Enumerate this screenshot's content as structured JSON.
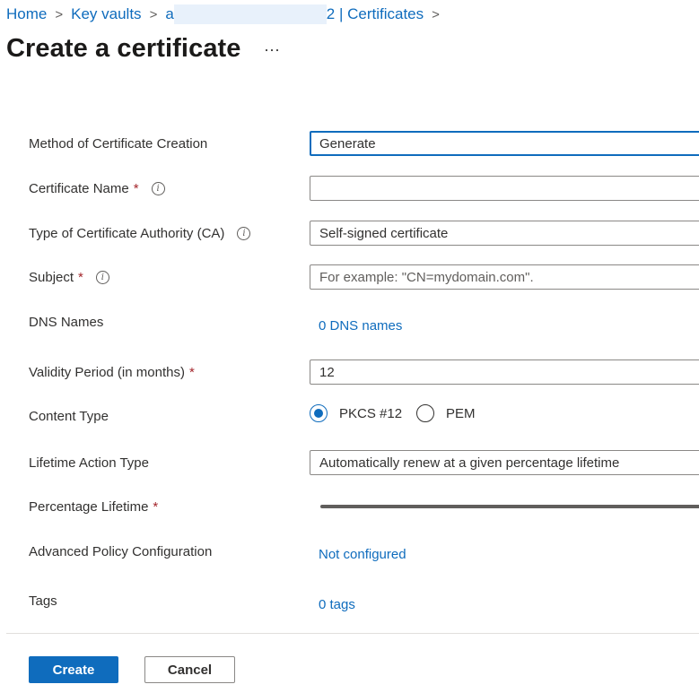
{
  "breadcrumb": {
    "home": "Home",
    "key_vaults": "Key vaults",
    "vault_prefix": "a",
    "vault_suffix": "2 | Certificates"
  },
  "page": {
    "title": "Create a certificate",
    "more": "···"
  },
  "form": {
    "method": {
      "label": "Method of Certificate Creation",
      "value": "Generate"
    },
    "certificate_name": {
      "label": "Certificate Name",
      "required": "*",
      "value": ""
    },
    "ca_type": {
      "label": "Type of Certificate Authority (CA)",
      "value": "Self-signed certificate"
    },
    "subject": {
      "label": "Subject",
      "required": "*",
      "placeholder": "For example: \"CN=mydomain.com\"."
    },
    "dns_names": {
      "label": "DNS Names",
      "value": "0 DNS names"
    },
    "validity": {
      "label": "Validity Period (in months)",
      "required": "*",
      "value": "12"
    },
    "content_type": {
      "label": "Content Type",
      "options": [
        "PKCS #12",
        "PEM"
      ],
      "selected": "PKCS #12"
    },
    "lifetime_action": {
      "label": "Lifetime Action Type",
      "value": "Automatically renew at a given percentage lifetime"
    },
    "percentage_lifetime": {
      "label": "Percentage Lifetime",
      "required": "*"
    },
    "advanced_policy": {
      "label": "Advanced Policy Configuration",
      "value": "Not configured"
    },
    "tags": {
      "label": "Tags",
      "value": "0 tags"
    }
  },
  "footer": {
    "create": "Create",
    "cancel": "Cancel"
  },
  "icons": {
    "info": "info-icon",
    "chevron": "chevron-right-icon"
  },
  "colors": {
    "accent": "#0f6cbd",
    "required": "#a4262c"
  }
}
